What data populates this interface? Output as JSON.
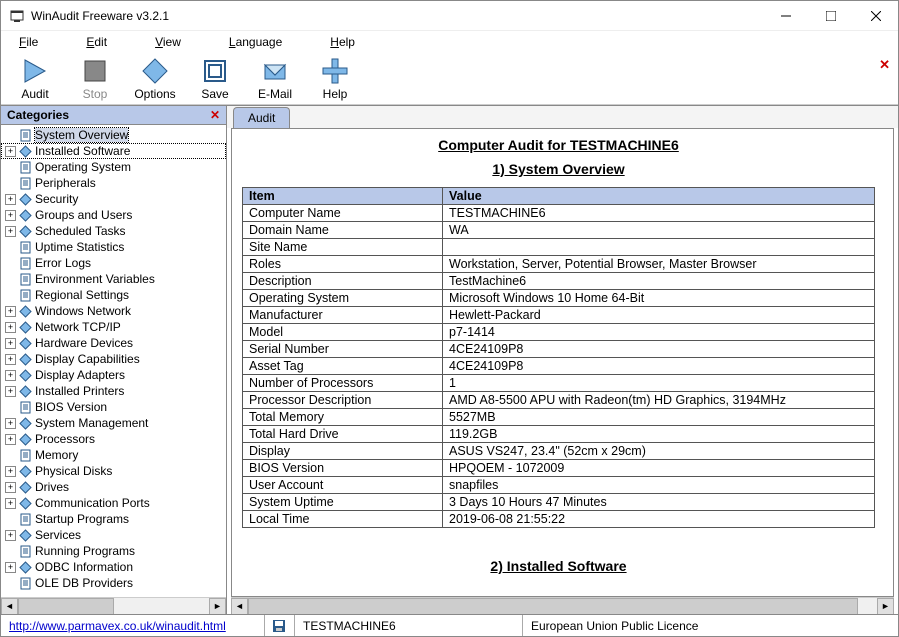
{
  "window": {
    "title": "WinAudit Freeware v3.2.1"
  },
  "menubar": [
    "File",
    "Edit",
    "View",
    "Language",
    "Help"
  ],
  "toolbar": {
    "audit": "Audit",
    "stop": "Stop",
    "options": "Options",
    "save": "Save",
    "email": "E-Mail",
    "help": "Help"
  },
  "sidebar": {
    "title": "Categories",
    "items": [
      {
        "label": "System Overview",
        "exp": "",
        "icon": "page",
        "selected": true
      },
      {
        "label": "Installed Software",
        "exp": "+",
        "icon": "diamond",
        "dotted": true
      },
      {
        "label": "Operating System",
        "exp": "",
        "icon": "page"
      },
      {
        "label": "Peripherals",
        "exp": "",
        "icon": "page"
      },
      {
        "label": "Security",
        "exp": "+",
        "icon": "diamond"
      },
      {
        "label": "Groups and Users",
        "exp": "+",
        "icon": "diamond"
      },
      {
        "label": "Scheduled Tasks",
        "exp": "+",
        "icon": "diamond"
      },
      {
        "label": "Uptime Statistics",
        "exp": "",
        "icon": "page"
      },
      {
        "label": "Error Logs",
        "exp": "",
        "icon": "page"
      },
      {
        "label": "Environment Variables",
        "exp": "",
        "icon": "page"
      },
      {
        "label": "Regional Settings",
        "exp": "",
        "icon": "page"
      },
      {
        "label": "Windows Network",
        "exp": "+",
        "icon": "diamond"
      },
      {
        "label": "Network TCP/IP",
        "exp": "+",
        "icon": "diamond"
      },
      {
        "label": "Hardware Devices",
        "exp": "+",
        "icon": "diamond"
      },
      {
        "label": "Display Capabilities",
        "exp": "+",
        "icon": "diamond"
      },
      {
        "label": "Display Adapters",
        "exp": "+",
        "icon": "diamond"
      },
      {
        "label": "Installed Printers",
        "exp": "+",
        "icon": "diamond"
      },
      {
        "label": "BIOS Version",
        "exp": "",
        "icon": "page"
      },
      {
        "label": "System Management",
        "exp": "+",
        "icon": "diamond"
      },
      {
        "label": "Processors",
        "exp": "+",
        "icon": "diamond"
      },
      {
        "label": "Memory",
        "exp": "",
        "icon": "page"
      },
      {
        "label": "Physical Disks",
        "exp": "+",
        "icon": "diamond"
      },
      {
        "label": "Drives",
        "exp": "+",
        "icon": "diamond"
      },
      {
        "label": "Communication Ports",
        "exp": "+",
        "icon": "diamond"
      },
      {
        "label": "Startup Programs",
        "exp": "",
        "icon": "page"
      },
      {
        "label": "Services",
        "exp": "+",
        "icon": "diamond"
      },
      {
        "label": "Running Programs",
        "exp": "",
        "icon": "page"
      },
      {
        "label": "ODBC Information",
        "exp": "+",
        "icon": "diamond"
      },
      {
        "label": "OLE DB Providers",
        "exp": "",
        "icon": "page"
      }
    ]
  },
  "tab": {
    "label": "Audit"
  },
  "doc": {
    "title": "Computer Audit for TESTMACHINE6",
    "section1": "1) System Overview",
    "section2": "2) Installed Software",
    "headers": {
      "item": "Item",
      "value": "Value"
    },
    "rows": [
      {
        "k": "Computer Name",
        "v": "TESTMACHINE6"
      },
      {
        "k": "Domain Name",
        "v": "WA"
      },
      {
        "k": "Site Name",
        "v": ""
      },
      {
        "k": "Roles",
        "v": "Workstation, Server, Potential Browser, Master Browser"
      },
      {
        "k": "Description",
        "v": "TestMachine6"
      },
      {
        "k": "Operating System",
        "v": "Microsoft Windows 10 Home 64-Bit"
      },
      {
        "k": "Manufacturer",
        "v": "Hewlett-Packard"
      },
      {
        "k": "Model",
        "v": "p7-1414"
      },
      {
        "k": "Serial Number",
        "v": "4CE24109P8"
      },
      {
        "k": "Asset Tag",
        "v": "4CE24109P8"
      },
      {
        "k": "Number of Processors",
        "v": "1"
      },
      {
        "k": "Processor Description",
        "v": "AMD A8-5500 APU with Radeon(tm) HD Graphics, 3194MHz"
      },
      {
        "k": "Total Memory",
        "v": "5527MB"
      },
      {
        "k": "Total Hard Drive",
        "v": "119.2GB"
      },
      {
        "k": "Display",
        "v": "ASUS VS247, 23.4\" (52cm x 29cm)"
      },
      {
        "k": "BIOS Version",
        "v": "HPQOEM - 1072009"
      },
      {
        "k": "User Account",
        "v": "snapfiles"
      },
      {
        "k": "System Uptime",
        "v": "3 Days 10 Hours 47 Minutes"
      },
      {
        "k": "Local Time",
        "v": "2019-06-08 21:55:22"
      }
    ]
  },
  "statusbar": {
    "link": "http://www.parmavex.co.uk/winaudit.html",
    "machine": "TESTMACHINE6",
    "licence": "European Union Public Licence"
  }
}
